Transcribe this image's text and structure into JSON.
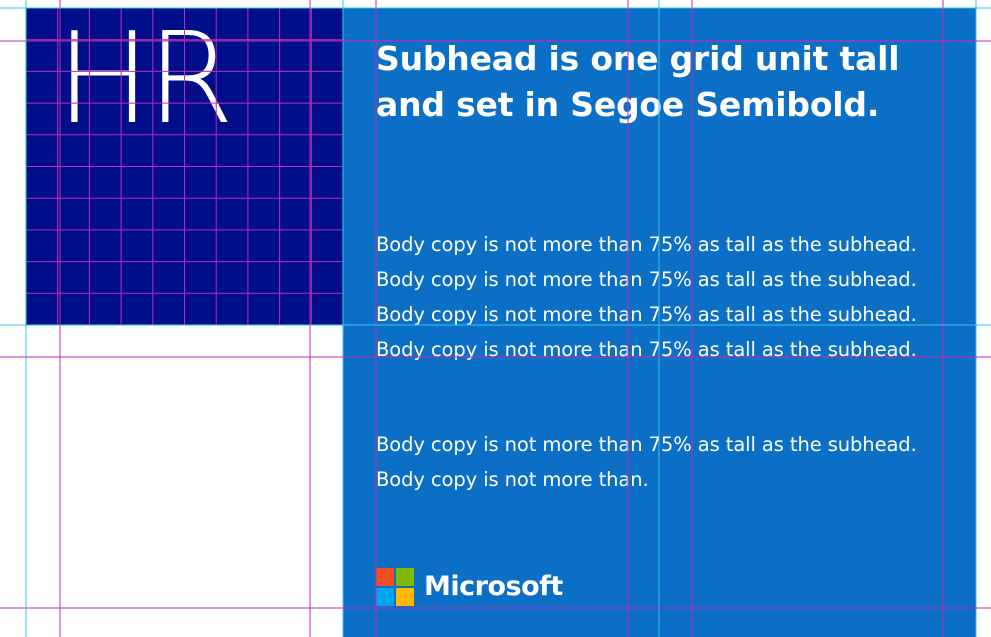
{
  "heading": {
    "title": "HR"
  },
  "subhead": {
    "text": "Subhead is one grid unit tall and set in Segoe Semibold."
  },
  "body": {
    "paragraph_1": "Body copy is not more than 75% as tall as the subhead. Body copy is not more than 75% as tall as the subhead. Body copy is not more than 75% as tall as the subhead. Body copy is not more than 75% as tall as the subhead.",
    "paragraph_2": "Body copy is not more than 75% as tall as the subhead. Body copy is not more than."
  },
  "logo": {
    "wordmark": "Microsoft",
    "colors": {
      "red": "#f25022",
      "green": "#7fba00",
      "blue": "#00a4ef",
      "yellow": "#ffb900"
    }
  },
  "colors": {
    "navy": "#000e8a",
    "blue_panel": "#0b6fc6",
    "grid_magenta": "#c22ab4",
    "grid_cyan": "#33c6e8",
    "background": "#ffffff"
  }
}
